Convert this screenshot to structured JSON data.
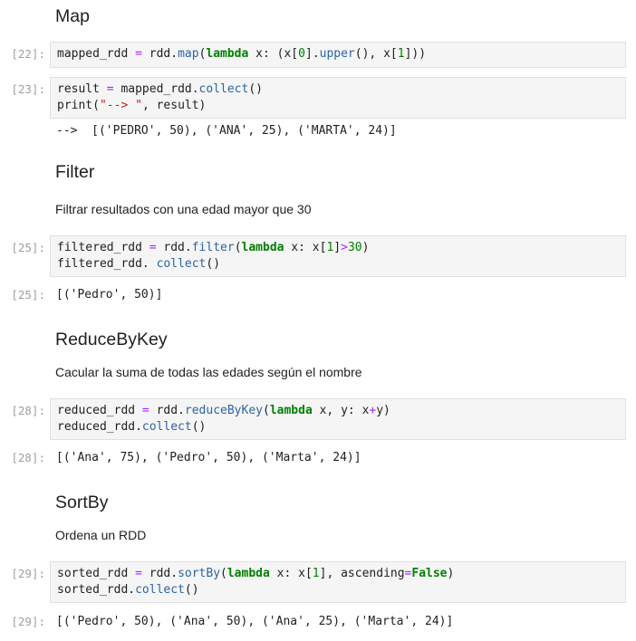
{
  "sections": {
    "map": {
      "heading": "Map",
      "cells": [
        {
          "prompt": "[22]:",
          "code": [
            [
              [
                "mapped_rdd ",
                ""
              ],
              [
                "=",
                "op"
              ],
              [
                " rdd.",
                ""
              ],
              [
                "map",
                "fn"
              ],
              [
                "(",
                ""
              ],
              [
                "lambda",
                "kw"
              ],
              [
                " x: (x[",
                ""
              ],
              [
                "0",
                "num"
              ],
              [
                "].",
                ""
              ],
              [
                "upper",
                "fn"
              ],
              [
                "(), x[",
                ""
              ],
              [
                "1",
                "num"
              ],
              [
                "]))",
                ""
              ]
            ]
          ]
        },
        {
          "prompt": "[23]:",
          "code": [
            [
              [
                "result ",
                ""
              ],
              [
                "=",
                "op"
              ],
              [
                " mapped_rdd.",
                ""
              ],
              [
                "collect",
                "fn"
              ],
              [
                "()",
                ""
              ]
            ],
            [
              [
                "print(",
                ""
              ],
              [
                "\"--> \"",
                "str"
              ],
              [
                ", result)",
                ""
              ]
            ]
          ],
          "output": "-->  [('PEDRO', 50), ('ANA', 25), ('MARTA', 24)]"
        }
      ]
    },
    "filter": {
      "heading": "Filter",
      "description": "Filtrar resultados con una edad mayor que 30",
      "cells": [
        {
          "prompt": "[25]:",
          "code": [
            [
              [
                "filtered_rdd ",
                ""
              ],
              [
                "=",
                "op"
              ],
              [
                " rdd.",
                ""
              ],
              [
                "filter",
                "fn"
              ],
              [
                "(",
                ""
              ],
              [
                "lambda",
                "kw"
              ],
              [
                " x: x[",
                ""
              ],
              [
                "1",
                "num"
              ],
              [
                "]",
                ""
              ],
              [
                ">",
                "op"
              ],
              [
                "30",
                "num"
              ],
              [
                ")",
                ""
              ]
            ],
            [
              [
                "filtered_rdd. ",
                ""
              ],
              [
                "collect",
                "fn"
              ],
              [
                "()",
                ""
              ]
            ]
          ],
          "output_prompt": "[25]:",
          "output": "[('Pedro', 50)]"
        }
      ]
    },
    "reducebykey": {
      "heading": "ReduceByKey",
      "description": "Cacular la suma de todas las edades según el nombre",
      "cells": [
        {
          "prompt": "[28]:",
          "code": [
            [
              [
                "reduced_rdd ",
                ""
              ],
              [
                "=",
                "op"
              ],
              [
                " rdd.",
                ""
              ],
              [
                "reduceByKey",
                "fn"
              ],
              [
                "(",
                ""
              ],
              [
                "lambda",
                "kw"
              ],
              [
                " x, y: x",
                ""
              ],
              [
                "+",
                "op"
              ],
              [
                "y)",
                ""
              ]
            ],
            [
              [
                "reduced_rdd.",
                ""
              ],
              [
                "collect",
                "fn"
              ],
              [
                "()",
                ""
              ]
            ]
          ],
          "output_prompt": "[28]:",
          "output": "[('Ana', 75), ('Pedro', 50), ('Marta', 24)]"
        }
      ]
    },
    "sortby": {
      "heading": "SortBy",
      "description": "Ordena un RDD",
      "cells": [
        {
          "prompt": "[29]:",
          "code": [
            [
              [
                "sorted_rdd ",
                ""
              ],
              [
                "=",
                "op"
              ],
              [
                " rdd.",
                ""
              ],
              [
                "sortBy",
                "fn"
              ],
              [
                "(",
                ""
              ],
              [
                "lambda",
                "kw"
              ],
              [
                " x: x[",
                ""
              ],
              [
                "1",
                "num"
              ],
              [
                "], ascending",
                ""
              ],
              [
                "=",
                "op"
              ],
              [
                "False",
                "kw"
              ],
              [
                ")",
                ""
              ]
            ],
            [
              [
                "sorted_rdd.",
                ""
              ],
              [
                "collect",
                "fn"
              ],
              [
                "()",
                ""
              ]
            ]
          ],
          "output_prompt": "[29]:",
          "output": "[('Pedro', 50), ('Ana', 50), ('Ana', 25), ('Marta', 24)]"
        }
      ]
    }
  }
}
